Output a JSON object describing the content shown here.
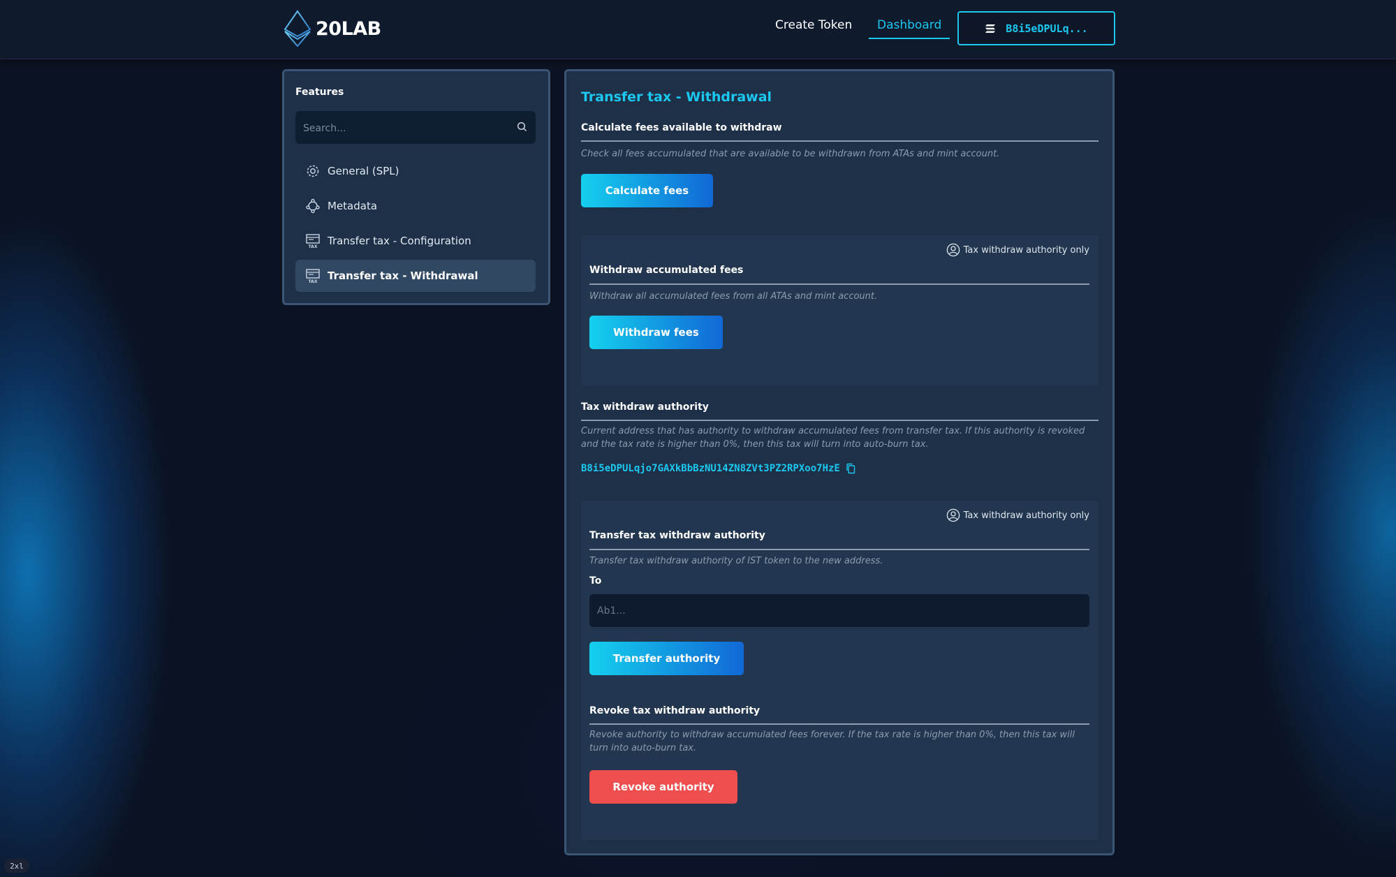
{
  "header": {
    "logo_text": "20LAB",
    "nav": {
      "create_token": "Create Token",
      "dashboard": "Dashboard"
    },
    "wallet": {
      "label": "B8i5eDPULq..."
    }
  },
  "sidebar": {
    "title": "Features",
    "search_placeholder": "Search...",
    "items": [
      {
        "label": "General (SPL)",
        "icon": "gear-icon"
      },
      {
        "label": "Metadata",
        "icon": "metadata-icon"
      },
      {
        "label": "Transfer tax - Configuration",
        "icon": "tax-icon"
      },
      {
        "label": "Transfer tax - Withdrawal",
        "icon": "tax-icon",
        "active": true
      }
    ]
  },
  "main": {
    "title": "Transfer tax - Withdrawal",
    "calculate": {
      "title": "Calculate fees available to withdraw",
      "description": "Check all fees accumulated that are available to be withdrawn from ATAs and mint account.",
      "button": "Calculate fees"
    },
    "withdraw": {
      "badge": "Tax withdraw authority only",
      "title": "Withdraw accumulated fees",
      "description": "Withdraw all accumulated fees from all ATAs and mint account.",
      "button": "Withdraw fees"
    },
    "authority": {
      "title": "Tax withdraw authority",
      "description_line1": "Current address that has authority to withdraw accumulated fees from transfer tax. If this authority is revoked",
      "description_line2": "and the tax rate is higher than 0%, then this tax will turn into auto-burn tax.",
      "address": "B8i5eDPULqjo7GAXkBbBzNU14ZN8ZVt3PZ2RPXoo7HzE"
    },
    "transfer": {
      "badge": "Tax withdraw authority only",
      "title": "Transfer tax withdraw authority",
      "description": "Transfer tax withdraw authority of IST token to the new address.",
      "to_label": "To",
      "to_placeholder": "Ab1...",
      "button": "Transfer authority"
    },
    "revoke": {
      "title": "Revoke tax withdraw authority",
      "description_line1": "Revoke authority to withdraw accumulated fees forever. If the tax rate is higher than 0%, then this tax will",
      "description_line2": "turn into auto-burn tax.",
      "button": "Revoke authority"
    }
  },
  "breakpoint_tag": "2xl",
  "colors": {
    "accent": "#1cc8f0",
    "danger": "#ef4e4e",
    "panel": "#1d3048",
    "background": "#0b1222"
  }
}
